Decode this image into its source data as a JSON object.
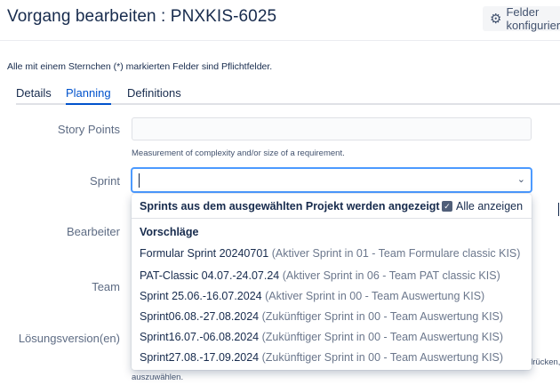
{
  "dialog": {
    "title": "Vorgang bearbeiten : PNXKIS-6025",
    "configure_button": "Felder konfigurieren",
    "required_note": "Alle mit einem Sternchen (*) markierten Felder sind Pflichtfelder."
  },
  "tabs": [
    {
      "label": "Details",
      "active": false
    },
    {
      "label": "Planning",
      "active": true
    },
    {
      "label": "Definitions",
      "active": false
    }
  ],
  "fields": {
    "story_points": {
      "label": "Story Points",
      "value": "",
      "description": "Measurement of complexity and/or size of a requirement."
    },
    "sprint": {
      "label": "Sprint",
      "value": ""
    },
    "bearbeiter": {
      "label": "Bearbeiter"
    },
    "team": {
      "label": "Team"
    },
    "loesungsversion": {
      "label": "Lösungsversion(en)"
    }
  },
  "partial_texts": {
    "right_fragment": "drücken,",
    "bottom_fragment": "auszuwählen."
  },
  "dropdown": {
    "header_text": "Sprints aus dem ausgewählten Projekt werden angezeigt",
    "show_all_label": "Alle anzeigen",
    "show_all_checked": true,
    "group_label": "Vorschläge",
    "items": [
      {
        "name": "Formular Sprint 20240701",
        "info": "(Aktiver Sprint in 01 - Team Formulare classic KIS)"
      },
      {
        "name": "PAT-Classic 04.07.-24.07.24",
        "info": "(Aktiver Sprint in 06 - Team PAT classic KIS)"
      },
      {
        "name": "Sprint 25.06.-16.07.2024",
        "info": "(Aktiver Sprint in 00 - Team Auswertung KIS)"
      },
      {
        "name": "Sprint06.08.-27.08.2024",
        "info": "(Zukünftiger Sprint in 00 - Team Auswertung KIS)"
      },
      {
        "name": "Sprint16.07.-06.08.2024",
        "info": "(Zukünftiger Sprint in 00 - Team Auswertung KIS)"
      },
      {
        "name": "Sprint27.08.-17.09.2024",
        "info": "(Zukünftiger Sprint in 00 - Team Auswertung KIS)"
      }
    ]
  },
  "icons": {
    "configure": "gear-icon",
    "select_toggle": "chevron-down-icon",
    "checkbox": "check-icon"
  },
  "colors": {
    "accent": "#0052cc",
    "focus_border": "#4c9aff",
    "checkbox": "#505f79"
  }
}
